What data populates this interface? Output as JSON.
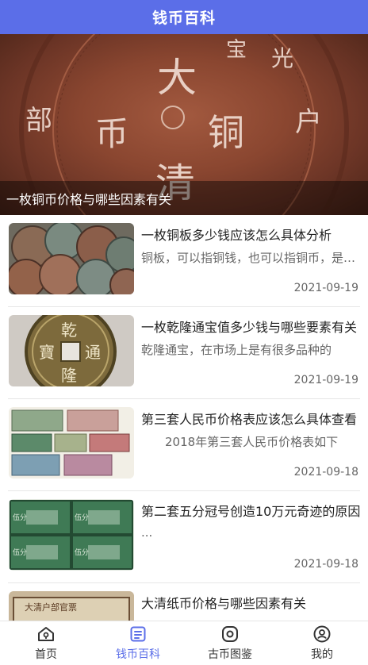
{
  "header": {
    "title": "钱币百科"
  },
  "banner": {
    "caption": "一枚铜币价格与哪些因素有关",
    "coin_chars": [
      "大",
      "清",
      "铜",
      "币",
      "部",
      "户",
      "光",
      "宝"
    ]
  },
  "articles": [
    {
      "title": "一枚铜板多少钱应该怎么具体分析",
      "summary": "铜板，可以指铜钱，也可以指铜币，是铜制的钱币",
      "date": "2021-09-19",
      "thumb": "copper-coins-pile"
    },
    {
      "title": "一枚乾隆通宝值多少钱与哪些要素有关",
      "summary": "乾隆通宝，在市场上是有很多品种的",
      "date": "2021-09-19",
      "thumb": "qianlong-coin"
    },
    {
      "title": "第三套人民币价格表应该怎么具体查看",
      "summary": "　　2018年第三套人民币价格表如下",
      "date": "2021-09-18",
      "thumb": "third-set-banknotes"
    },
    {
      "title": "第二套五分冠号创造10万元奇迹的原因",
      "summary": "...",
      "date": "2021-09-18",
      "thumb": "five-fen-notes"
    },
    {
      "title": "大清纸币价格与哪些因素有关",
      "summary": "",
      "date": "",
      "thumb": "qing-paper-money"
    }
  ],
  "thumb_texts": {
    "qianlong_chars": [
      "乾",
      "隆",
      "通",
      "寶"
    ],
    "five_fen_labels": [
      "伍分",
      "伍分",
      "伍分",
      "伍分"
    ],
    "qing_note_text": "大清户部官票"
  },
  "tabbar": {
    "tabs": [
      {
        "label": "首页",
        "icon": "home-icon",
        "active": false
      },
      {
        "label": "钱币百科",
        "icon": "encyclopedia-icon",
        "active": true
      },
      {
        "label": "古币图鉴",
        "icon": "coin-catalog-icon",
        "active": false
      },
      {
        "label": "我的",
        "icon": "profile-icon",
        "active": false
      }
    ]
  },
  "colors": {
    "accent": "#5b6ee8",
    "copper": "#8a4630",
    "text_secondary": "#666666"
  }
}
